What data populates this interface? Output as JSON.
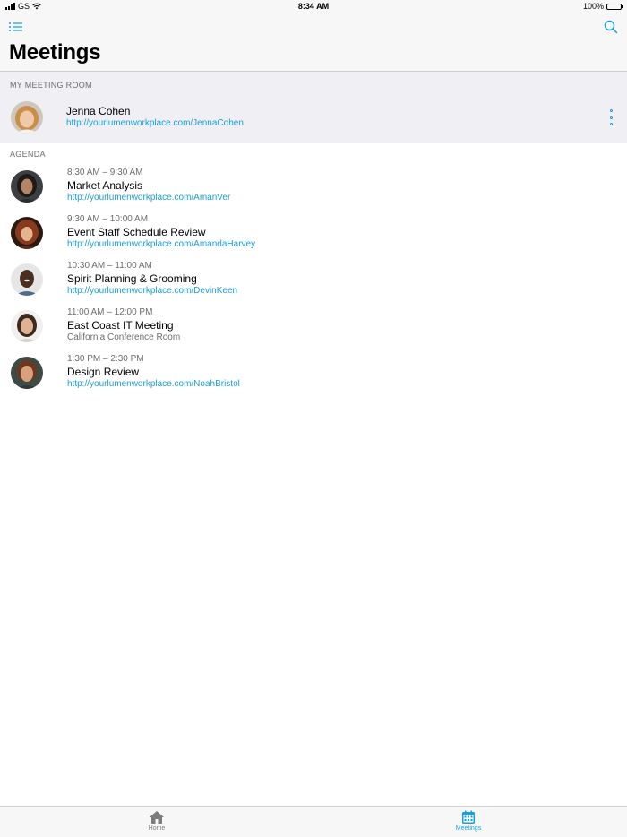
{
  "status_bar": {
    "carrier": "GS",
    "time": "8:34 AM",
    "battery": "100%"
  },
  "nav": {
    "title": "Meetings",
    "menu_icon": "list-icon",
    "search_icon": "search-icon"
  },
  "my_room": {
    "header": "MY MEETING ROOM",
    "name": "Jenna Cohen",
    "link": "http://yourlumenworkplace.com/JennaCohen",
    "more_icon": "more-vertical-icon"
  },
  "agenda": {
    "header": "AGENDA",
    "items": [
      {
        "time": "8:30 AM – 9:30 AM",
        "title": "Market Analysis",
        "link": "http://yourlumenworkplace.com/AmanVer",
        "location": ""
      },
      {
        "time": "9:30 AM – 10:00 AM",
        "title": "Event Staff Schedule Review",
        "link": "http://yourlumenworkplace.com/AmandaHarvey",
        "location": ""
      },
      {
        "time": "10:30 AM – 11:00 AM",
        "title": "Spirit Planning & Grooming",
        "link": "http://yourlumenworkplace.com/DevinKeen",
        "location": ""
      },
      {
        "time": "11:00 AM – 12:00 PM",
        "title": "East Coast IT Meeting",
        "link": "",
        "location": "California Conference Room"
      },
      {
        "time": "1:30 PM – 2:30 PM",
        "title": "Design Review",
        "link": "http://yourlumenworkplace.com/NoahBristol",
        "location": ""
      }
    ]
  },
  "tabs": [
    {
      "label": "Home",
      "icon": "home-icon",
      "active": false
    },
    {
      "label": "Meetings",
      "icon": "calendar-icon",
      "active": true
    }
  ],
  "colors": {
    "accent": "#1a9fd8",
    "secondary_text": "#6d6d72",
    "section_background": "#efeff4",
    "bar_background": "#f7f7f7"
  }
}
